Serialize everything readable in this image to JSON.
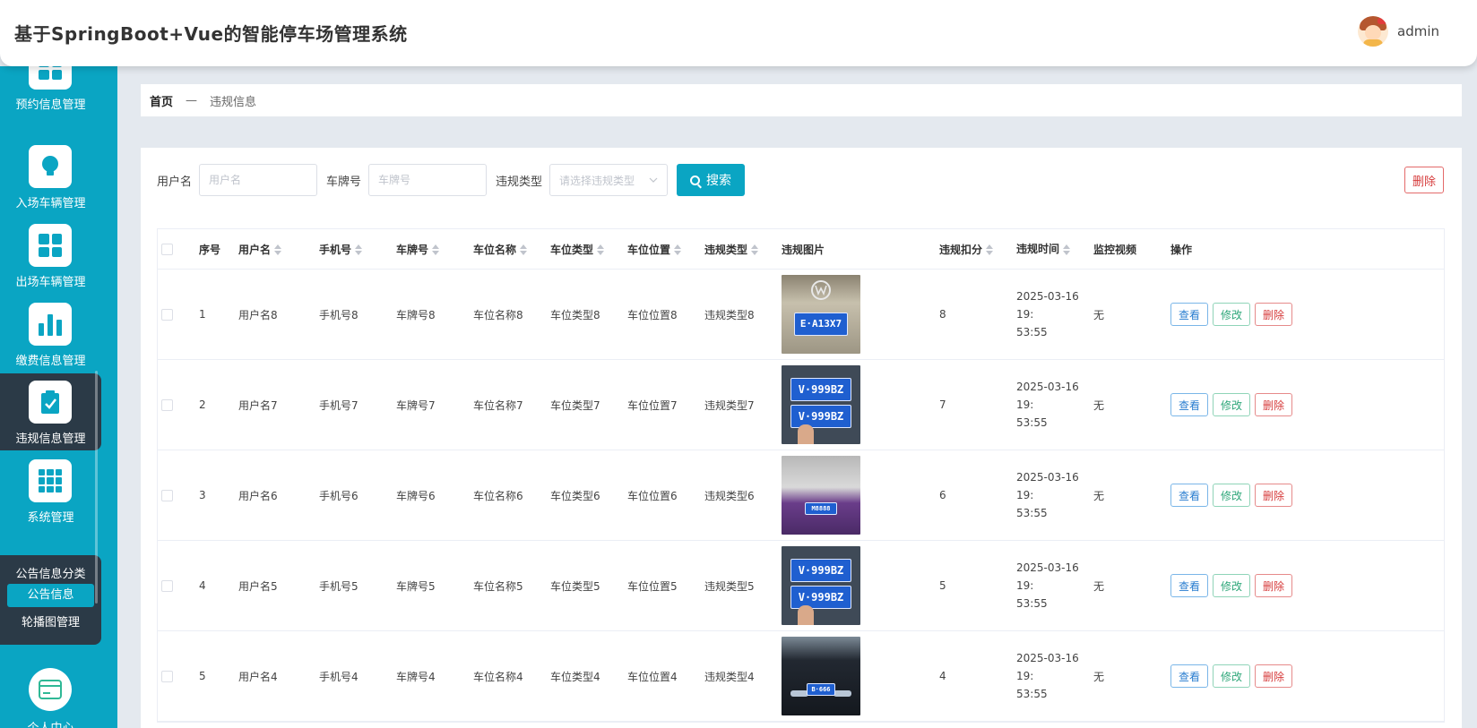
{
  "header": {
    "title": "基于SpringBoot+Vue的智能停车场管理系统",
    "username": "admin"
  },
  "sidebar": {
    "items": [
      {
        "label": "预约信息管理",
        "icon": "grid-icon"
      },
      {
        "label": "入场车辆管理",
        "icon": "bulb-icon"
      },
      {
        "label": "出场车辆管理",
        "icon": "grid-icon"
      },
      {
        "label": "缴费信息管理",
        "icon": "bar-chart-icon"
      },
      {
        "label": "违规信息管理",
        "icon": "clipboard-check-icon",
        "active": true
      },
      {
        "label": "系统管理",
        "icon": "apps-icon"
      }
    ],
    "submenu": [
      {
        "label": "公告信息分类"
      },
      {
        "label": "公告信息",
        "active": true
      },
      {
        "label": "轮播图管理"
      }
    ],
    "personal": {
      "label": "个人中心",
      "icon": "card-icon"
    }
  },
  "breadcrumb": {
    "home": "首页",
    "separator": "—",
    "current": "违规信息"
  },
  "search": {
    "username_label": "用户名",
    "username_placeholder": "用户名",
    "plate_label": "车牌号",
    "plate_placeholder": "车牌号",
    "vtype_label": "违规类型",
    "vtype_placeholder": "请选择违规类型",
    "search_button": "搜索",
    "delete_button": "删除"
  },
  "table": {
    "columns": {
      "no": "序号",
      "username": "用户名",
      "phone": "手机号",
      "plate": "车牌号",
      "space_name": "车位名称",
      "space_type": "车位类型",
      "space_pos": "车位位置",
      "vtype": "违规类型",
      "image": "违规图片",
      "points": "违规扣分",
      "time": "违规时间",
      "monitor": "监控视频",
      "ops": "操作"
    },
    "buttons": {
      "view": "查看",
      "edit": "修改",
      "delete": "删除"
    },
    "rows": [
      {
        "no": "1",
        "username": "用户名8",
        "phone": "手机号8",
        "plate": "车牌号8",
        "space_name": "车位名称8",
        "space_type": "车位类型8",
        "space_pos": "车位位置8",
        "vtype": "违规类型8",
        "image_plate": "E·A13X7",
        "points": "8",
        "time_a": "2025-03-16 19:",
        "time_b": "53:55",
        "monitor": "无"
      },
      {
        "no": "2",
        "username": "用户名7",
        "phone": "手机号7",
        "plate": "车牌号7",
        "space_name": "车位名称7",
        "space_type": "车位类型7",
        "space_pos": "车位位置7",
        "vtype": "违规类型7",
        "image_plate": "V·999BZ",
        "points": "7",
        "time_a": "2025-03-16 19:",
        "time_b": "53:55",
        "monitor": "无"
      },
      {
        "no": "3",
        "username": "用户名6",
        "phone": "手机号6",
        "plate": "车牌号6",
        "space_name": "车位名称6",
        "space_type": "车位类型6",
        "space_pos": "车位位置6",
        "vtype": "违规类型6",
        "image_plate": "M8888",
        "points": "6",
        "time_a": "2025-03-16 19:",
        "time_b": "53:55",
        "monitor": "无"
      },
      {
        "no": "4",
        "username": "用户名5",
        "phone": "手机号5",
        "plate": "车牌号5",
        "space_name": "车位名称5",
        "space_type": "车位类型5",
        "space_pos": "车位位置5",
        "vtype": "违规类型5",
        "image_plate": "V·999BZ",
        "points": "5",
        "time_a": "2025-03-16 19:",
        "time_b": "53:55",
        "monitor": "无"
      },
      {
        "no": "5",
        "username": "用户名4",
        "phone": "手机号4",
        "plate": "车牌号4",
        "space_name": "车位名称4",
        "space_type": "车位类型4",
        "space_pos": "车位位置4",
        "vtype": "违规类型4",
        "image_plate": "B·666",
        "points": "4",
        "time_a": "2025-03-16 19:",
        "time_b": "53:55",
        "monitor": "无"
      }
    ]
  }
}
